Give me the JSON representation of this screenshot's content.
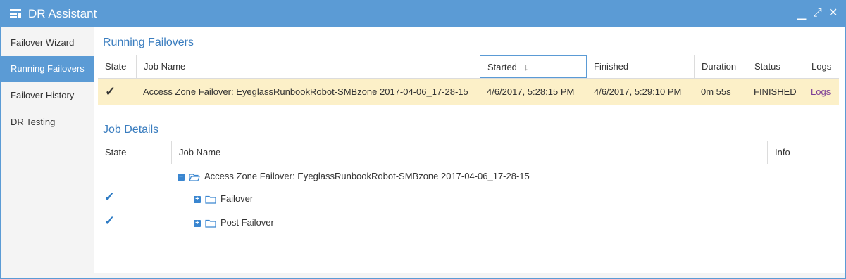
{
  "window": {
    "title": "DR Assistant",
    "icon": "app-grid-icon",
    "controls": [
      "minimize-icon",
      "maximize-icon",
      "close-icon"
    ]
  },
  "sidebar": {
    "items": [
      {
        "label": "Failover Wizard"
      },
      {
        "label": "Running Failovers",
        "active": true
      },
      {
        "label": "Failover History"
      },
      {
        "label": "DR Testing"
      }
    ]
  },
  "running": {
    "title": "Running Failovers",
    "columns": {
      "state": "State",
      "job_name": "Job Name",
      "started": "Started",
      "finished": "Finished",
      "duration": "Duration",
      "status": "Status",
      "logs": "Logs"
    },
    "rows": [
      {
        "state": "✓",
        "job_name": "Access Zone Failover: EyeglassRunbookRobot-SMBzone 2017-04-06_17-28-15",
        "started": "4/6/2017, 5:28:15 PM",
        "finished": "4/6/2017, 5:29:10 PM",
        "duration": "0m 55s",
        "status": "FINISHED",
        "logs": "Logs"
      }
    ]
  },
  "details": {
    "title": "Job Details",
    "columns": {
      "state": "State",
      "job_name": "Job Name",
      "info": "Info"
    },
    "tree": [
      {
        "state": "",
        "label": "Access Zone Failover: EyeglassRunbookRobot-SMBzone 2017-04-06_17-28-15",
        "toggle": "−",
        "folder": "open"
      },
      {
        "state": "✓",
        "label": "Failover",
        "toggle": "+",
        "folder": "closed"
      },
      {
        "state": "✓",
        "label": "Post Failover",
        "toggle": "+",
        "folder": "closed"
      }
    ]
  },
  "colors": {
    "accent": "#5b9bd5",
    "link": "#3a7dbf",
    "highlight_row": "#fcf0c8",
    "check": "#2e7bc4"
  }
}
